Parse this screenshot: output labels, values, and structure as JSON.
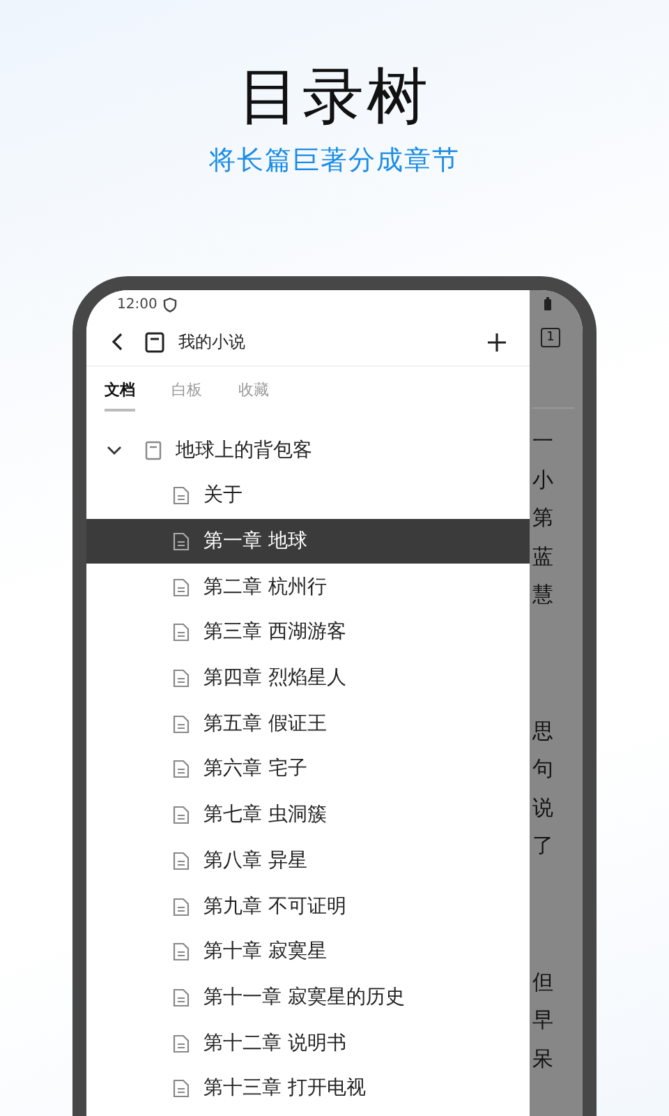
{
  "headline": {
    "title": "目录树",
    "subtitle": "将长篇巨著分成章节"
  },
  "status_bar": {
    "time": "12:00"
  },
  "app_bar": {
    "title": "我的小说"
  },
  "tabs": [
    {
      "label": "文档",
      "selected": true
    },
    {
      "label": "白板",
      "selected": false
    },
    {
      "label": "收藏",
      "selected": false
    }
  ],
  "tree": [
    {
      "label": "地球上的背包客",
      "expanded": true,
      "children": [
        {
          "label": "关于",
          "selected": false
        },
        {
          "label": "第一章 地球",
          "selected": true
        },
        {
          "label": "第二章 杭州行",
          "selected": false
        },
        {
          "label": "第三章 西湖游客",
          "selected": false
        },
        {
          "label": "第四章 烈焰星人",
          "selected": false
        },
        {
          "label": "第五章 假证王",
          "selected": false
        },
        {
          "label": "第六章 宅子",
          "selected": false
        },
        {
          "label": "第七章 虫洞簇",
          "selected": false
        },
        {
          "label": "第八章 异星",
          "selected": false
        },
        {
          "label": "第九章 不可证明",
          "selected": false
        },
        {
          "label": "第十章 寂寞星",
          "selected": false
        },
        {
          "label": "第十一章 寂寞星的历史",
          "selected": false
        },
        {
          "label": "第十二章 说明书",
          "selected": false
        },
        {
          "label": "第十三章 打开电视",
          "selected": false
        }
      ]
    }
  ],
  "behind_panel": {
    "page_count": "1",
    "text_columns": [
      [
        "一",
        "小",
        "第",
        "蓝",
        "慧"
      ],
      [
        "思",
        "句",
        "说",
        "了"
      ],
      [
        "但",
        "早",
        "呆"
      ]
    ]
  }
}
